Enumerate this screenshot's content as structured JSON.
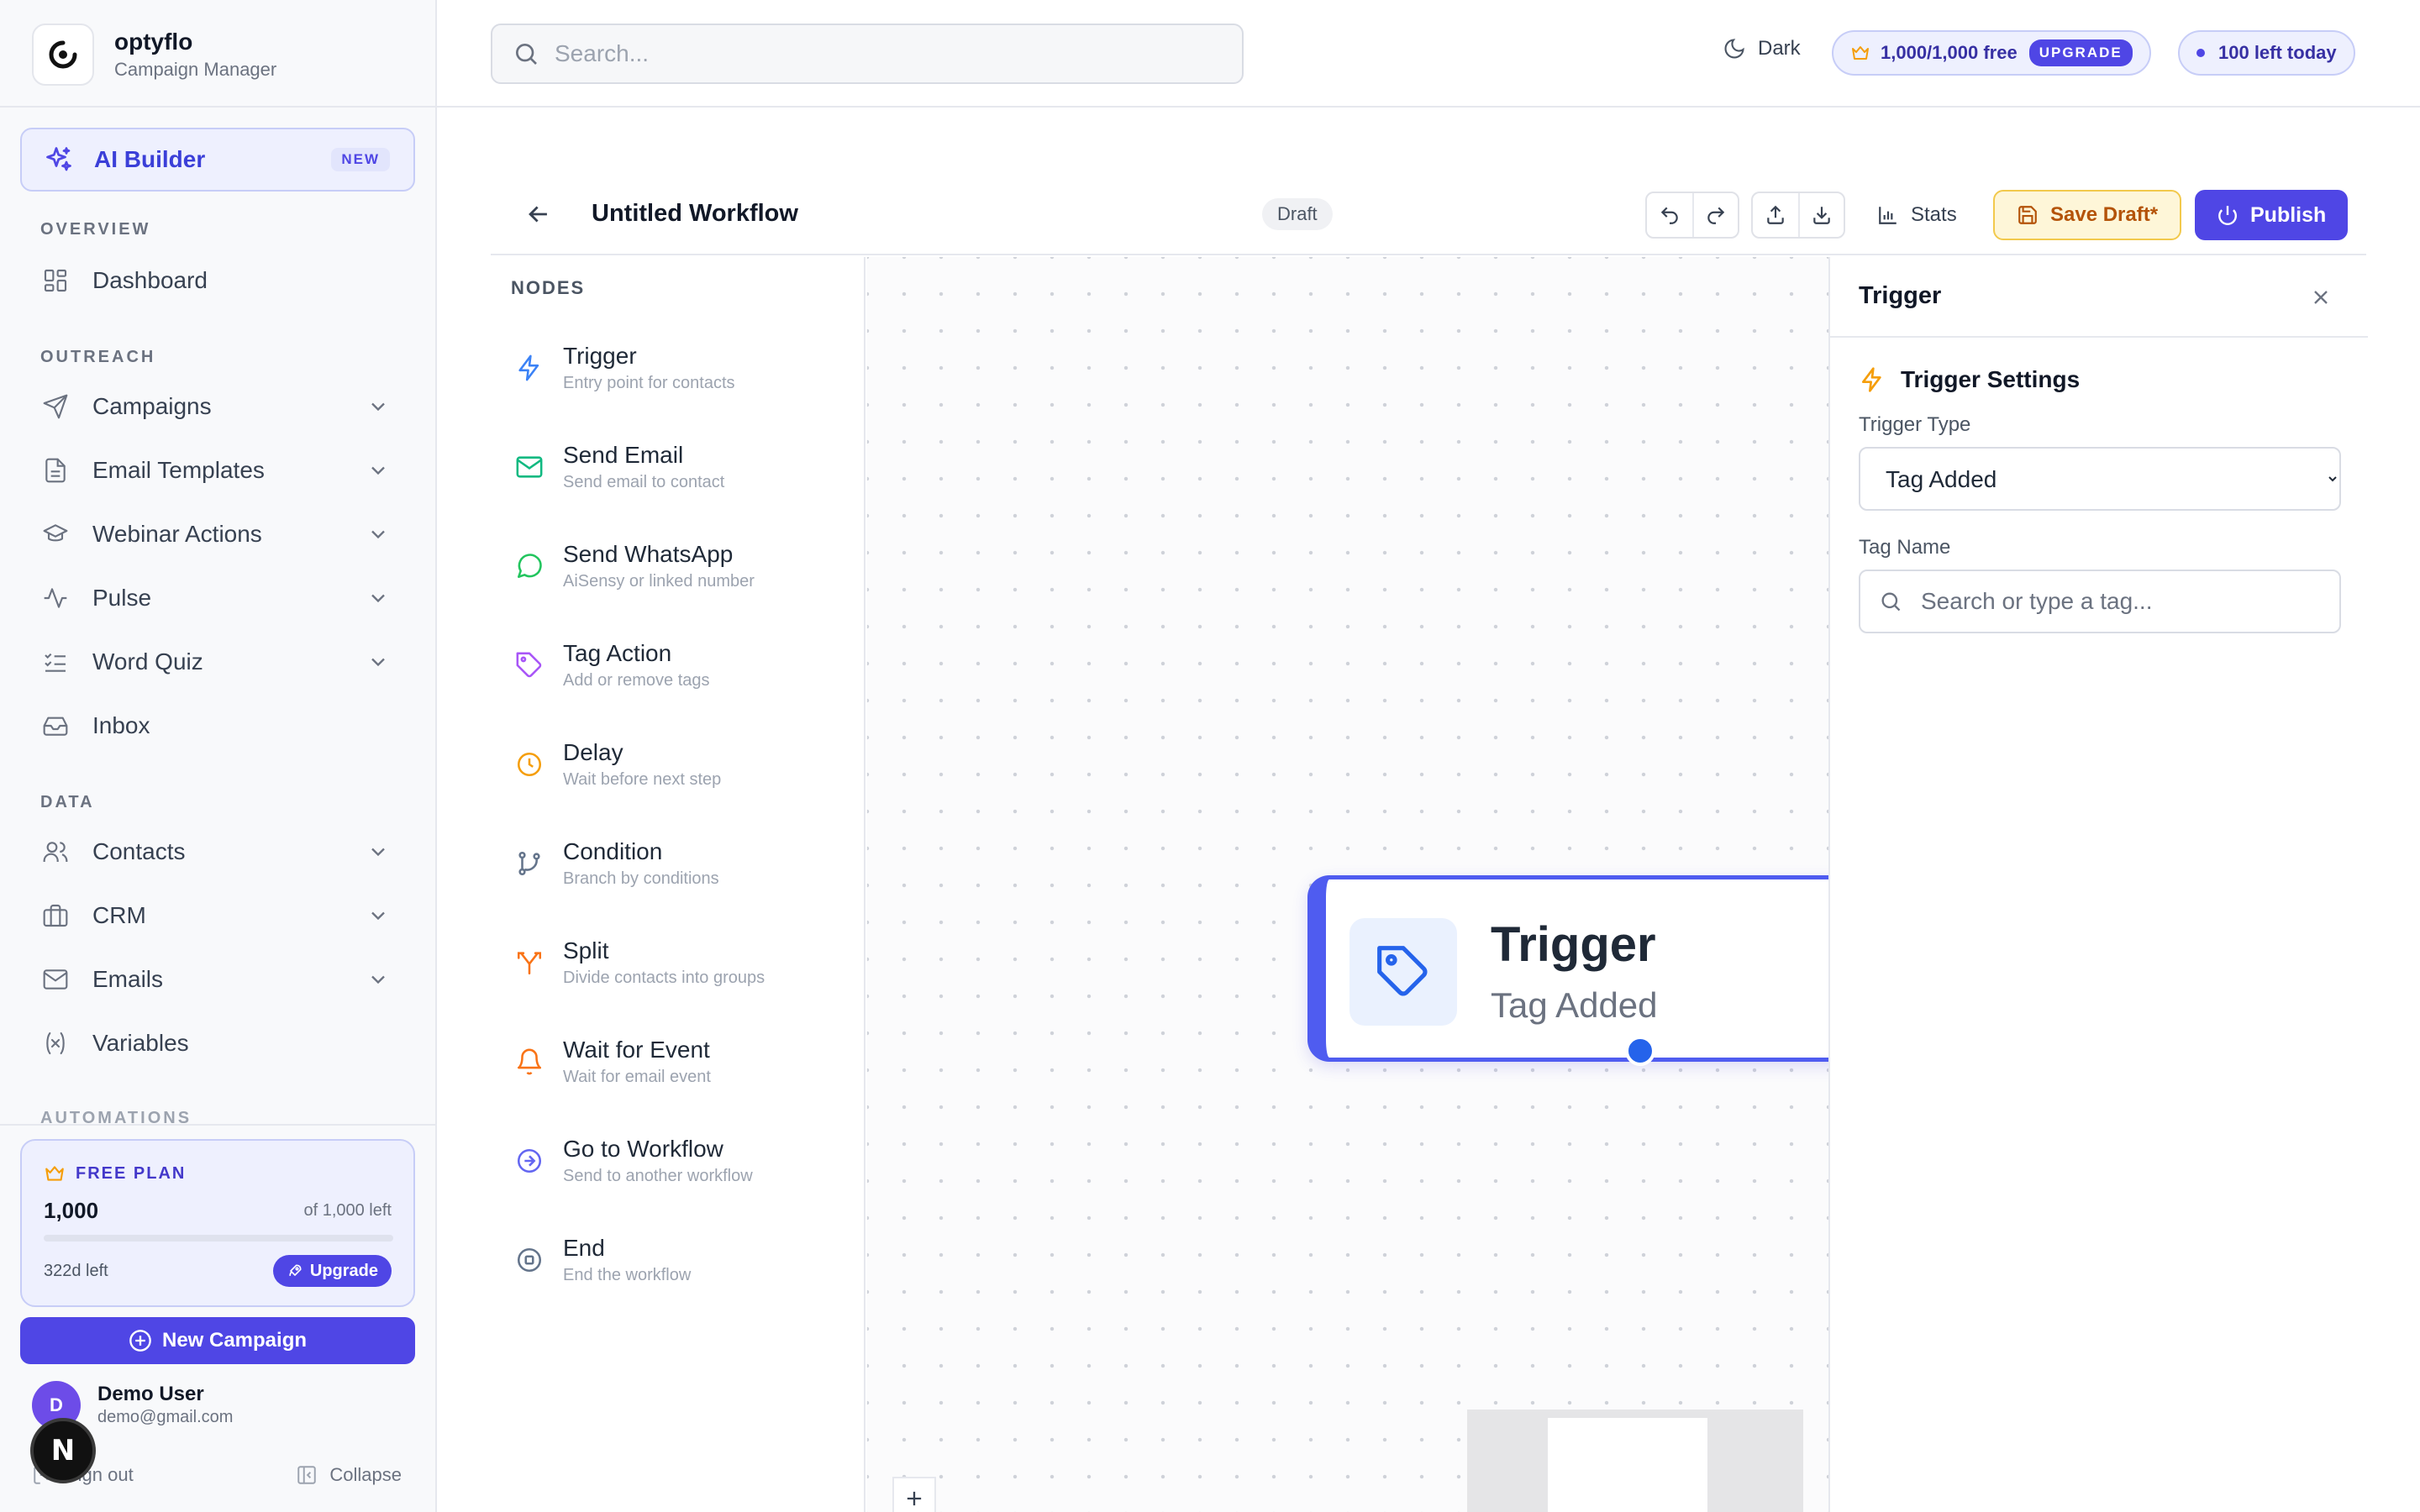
{
  "brand": {
    "name": "optyflo",
    "subtitle": "Campaign Manager"
  },
  "sidebar": {
    "ai_builder": {
      "label": "AI Builder",
      "badge": "NEW"
    },
    "sections": {
      "overview": "OVERVIEW",
      "outreach": "OUTREACH",
      "data": "DATA",
      "automations": "AUTOMATIONS"
    },
    "items": {
      "dashboard": "Dashboard",
      "campaigns": "Campaigns",
      "email_templates": "Email Templates",
      "webinar_actions": "Webinar Actions",
      "pulse": "Pulse",
      "word_quiz": "Word Quiz",
      "inbox": "Inbox",
      "contacts": "Contacts",
      "crm": "CRM",
      "emails": "Emails",
      "variables": "Variables"
    },
    "plan": {
      "title": "FREE PLAN",
      "count": "1,000",
      "of_left": "of 1,000 left",
      "usage_fraction": 0.0,
      "days_left": "322d left",
      "upgrade": "Upgrade"
    },
    "new_campaign": "New Campaign",
    "user": {
      "initial": "D",
      "name": "Demo User",
      "email": "demo@gmail.com"
    },
    "sign_out": "Sign out",
    "collapse": "Collapse",
    "dev_badge": "N"
  },
  "topbar": {
    "search_placeholder": "Search...",
    "dark_label": "Dark",
    "credits": "1,000/1,000 free",
    "upgrade": "UPGRADE",
    "daily_left": "100 left today"
  },
  "workflow": {
    "title": "Untitled Workflow",
    "status": "Draft",
    "stats": "Stats",
    "save": "Save Draft*",
    "publish": "Publish"
  },
  "nodes_panel": {
    "title": "NODES",
    "items": [
      {
        "name": "Trigger",
        "desc": "Entry point for contacts",
        "icon": "bolt-icon"
      },
      {
        "name": "Send Email",
        "desc": "Send email to contact",
        "icon": "mail-icon"
      },
      {
        "name": "Send WhatsApp",
        "desc": "AiSensy or linked number",
        "icon": "chat-icon"
      },
      {
        "name": "Tag Action",
        "desc": "Add or remove tags",
        "icon": "tag-icon"
      },
      {
        "name": "Delay",
        "desc": "Wait before next step",
        "icon": "clock-icon"
      },
      {
        "name": "Condition",
        "desc": "Branch by conditions",
        "icon": "branch-icon"
      },
      {
        "name": "Split",
        "desc": "Divide contacts into groups",
        "icon": "split-icon"
      },
      {
        "name": "Wait for Event",
        "desc": "Wait for email event",
        "icon": "bell-icon"
      },
      {
        "name": "Go to Workflow",
        "desc": "Send to another workflow",
        "icon": "arrow-circle-icon"
      },
      {
        "name": "End",
        "desc": "End the workflow",
        "icon": "stop-circle-icon"
      }
    ]
  },
  "canvas": {
    "node": {
      "title": "Trigger",
      "subtitle": "Tag Added"
    }
  },
  "settings": {
    "title": "Trigger",
    "section": "Trigger Settings",
    "trigger_type_label": "Trigger Type",
    "trigger_type_value": "Tag Added",
    "tag_name_label": "Tag Name",
    "tag_placeholder": "Search or type a tag..."
  },
  "colors": {
    "accent": "#4f46e5",
    "save_bg": "#fef6d8",
    "save_text": "#b45309"
  }
}
